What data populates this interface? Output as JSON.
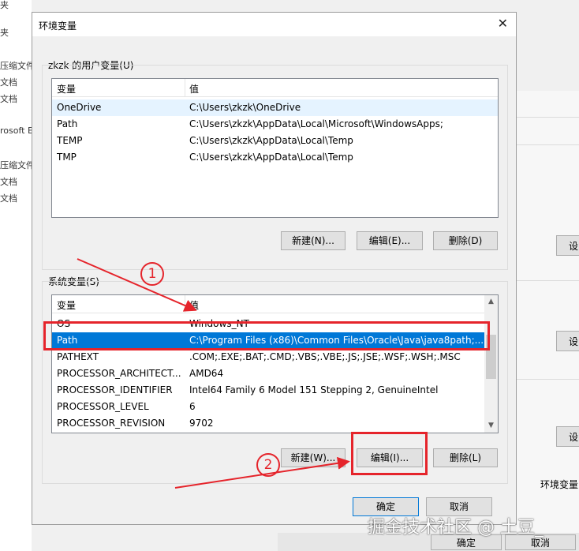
{
  "background": {
    "left_fragments": [
      "夹",
      "夹",
      "压缩文件",
      "文档",
      "文档",
      "rosoft Ed",
      "压缩文件",
      "文档",
      "文档"
    ],
    "right_buttons": [
      "设",
      "设",
      "设"
    ],
    "right_tab": "环境变量",
    "bottom_ok": "确定",
    "bottom_cancel": "取消"
  },
  "dialog": {
    "title": "环境变量",
    "close": "✕",
    "user_group_label": "zkzk 的用户变量(U)",
    "user_headers": [
      "变量",
      "值"
    ],
    "user_vars": [
      {
        "name": "OneDrive",
        "value": "C:\\Users\\zkzk\\OneDrive"
      },
      {
        "name": "Path",
        "value": "C:\\Users\\zkzk\\AppData\\Local\\Microsoft\\WindowsApps;"
      },
      {
        "name": "TEMP",
        "value": "C:\\Users\\zkzk\\AppData\\Local\\Temp"
      },
      {
        "name": "TMP",
        "value": "C:\\Users\\zkzk\\AppData\\Local\\Temp"
      }
    ],
    "user_buttons": {
      "new": "新建(N)...",
      "edit": "编辑(E)...",
      "delete": "删除(D)"
    },
    "system_group_label": "系统变量(S)",
    "system_headers": [
      "变量",
      "值"
    ],
    "system_vars": [
      {
        "name": "OS",
        "value": "Windows_NT"
      },
      {
        "name": "Path",
        "value": "C:\\Program Files (x86)\\Common Files\\Oracle\\Java\\java8path;..."
      },
      {
        "name": "PATHEXT",
        "value": ".COM;.EXE;.BAT;.CMD;.VBS;.VBE;.JS;.JSE;.WSF;.WSH;.MSC"
      },
      {
        "name": "PROCESSOR_ARCHITECT...",
        "value": "AMD64"
      },
      {
        "name": "PROCESSOR_IDENTIFIER",
        "value": "Intel64 Family 6 Model 151 Stepping 2, GenuineIntel"
      },
      {
        "name": "PROCESSOR_LEVEL",
        "value": "6"
      },
      {
        "name": "PROCESSOR_REVISION",
        "value": "9702"
      }
    ],
    "system_buttons": {
      "new": "新建(W)...",
      "edit": "编辑(I)...",
      "delete": "删除(L)"
    },
    "ok": "确定",
    "cancel": "取消"
  },
  "annotations": {
    "marker1": "1",
    "marker2": "2",
    "accent_color": "#e5242b"
  },
  "watermark": "掘金技术社区 @ 土豆_"
}
